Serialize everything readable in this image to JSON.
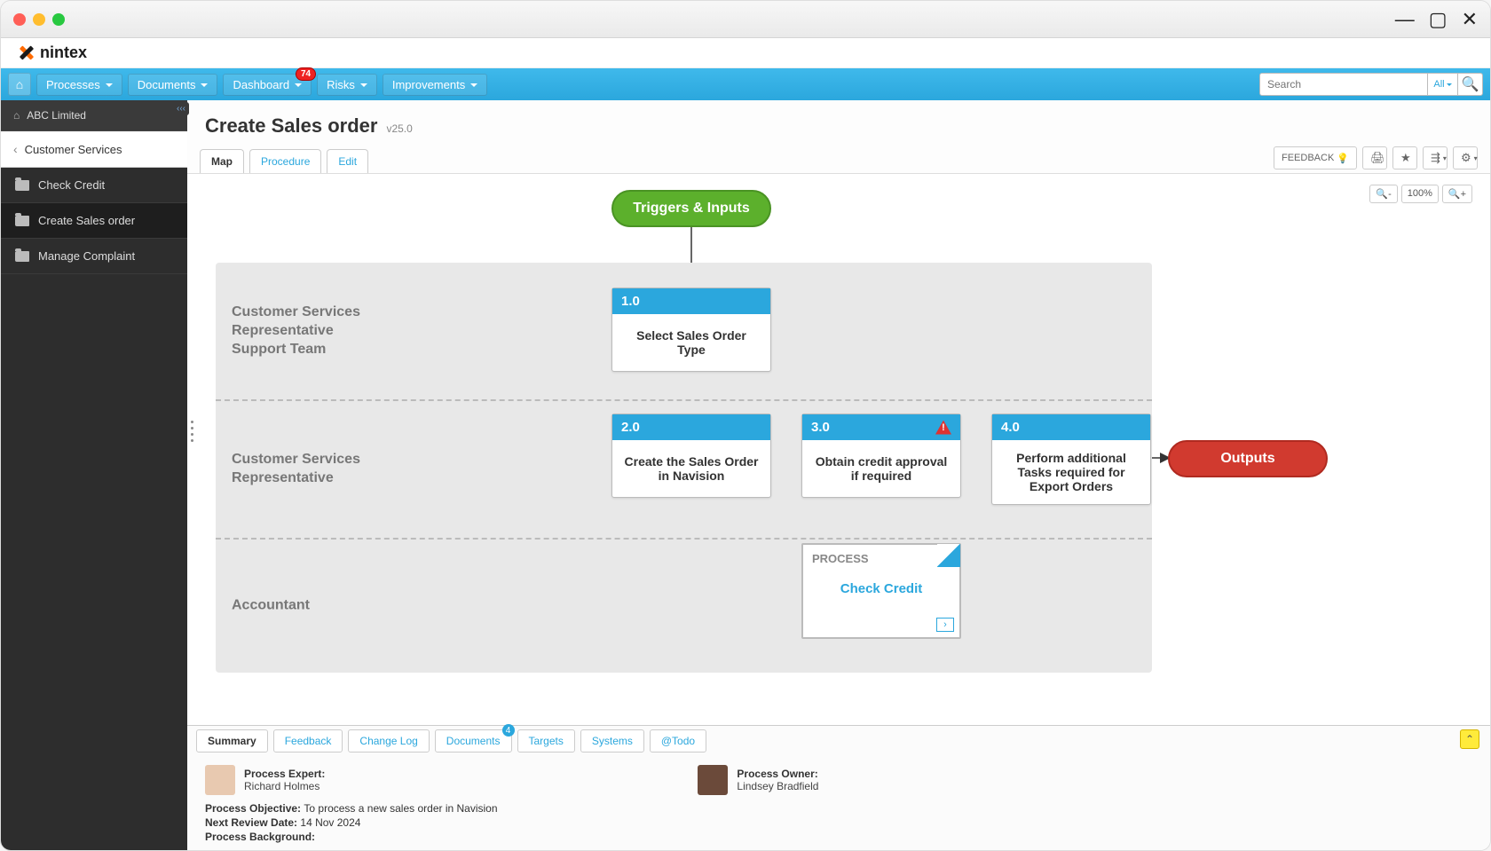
{
  "brand": "nintex",
  "nav": {
    "items": [
      "Processes",
      "Documents",
      "Dashboard",
      "Risks",
      "Improvements"
    ],
    "badge_index": 2,
    "badge": "74",
    "search_placeholder": "Search",
    "all_label": "All"
  },
  "sidebar": {
    "crumb_top": "ABC Limited",
    "crumb_back": "Customer Services",
    "items": [
      "Check Credit",
      "Create Sales order",
      "Manage Complaint"
    ],
    "active_index": 1
  },
  "page": {
    "title": "Create Sales order",
    "version": "v25.0",
    "tabs": [
      "Map",
      "Procedure",
      "Edit"
    ],
    "active_tab": 0,
    "feedback": "FEEDBACK",
    "zoom": "100%"
  },
  "diagram": {
    "triggers": "Triggers & Inputs",
    "outputs": "Outputs",
    "lanes": [
      "Customer Services Representative Support Team",
      "Customer Services Representative",
      "Accountant"
    ],
    "activities": {
      "a1": {
        "num": "1.0",
        "title": "Select Sales Order Type"
      },
      "a2": {
        "num": "2.0",
        "title": "Create the Sales Order in Navision"
      },
      "a3": {
        "num": "3.0",
        "title": "Obtain credit approval if required",
        "warn": true
      },
      "a4": {
        "num": "4.0",
        "title": "Perform additional Tasks required for Export Orders"
      }
    },
    "process": {
      "label": "PROCESS",
      "title": "Check Credit"
    }
  },
  "bottom_tabs": {
    "items": [
      "Summary",
      "Feedback",
      "Change Log",
      "Documents",
      "Targets",
      "Systems",
      "@Todo"
    ],
    "active": 0,
    "doc_count": "4"
  },
  "summary": {
    "expert_label": "Process Expert:",
    "expert_name": "Richard Holmes",
    "owner_label": "Process Owner:",
    "owner_name": "Lindsey Bradfield",
    "objective_label": "Process Objective:",
    "objective": "To process a new sales order in Navision",
    "review_label": "Next Review Date:",
    "review": "14 Nov 2024",
    "background_label": "Process Background:"
  }
}
